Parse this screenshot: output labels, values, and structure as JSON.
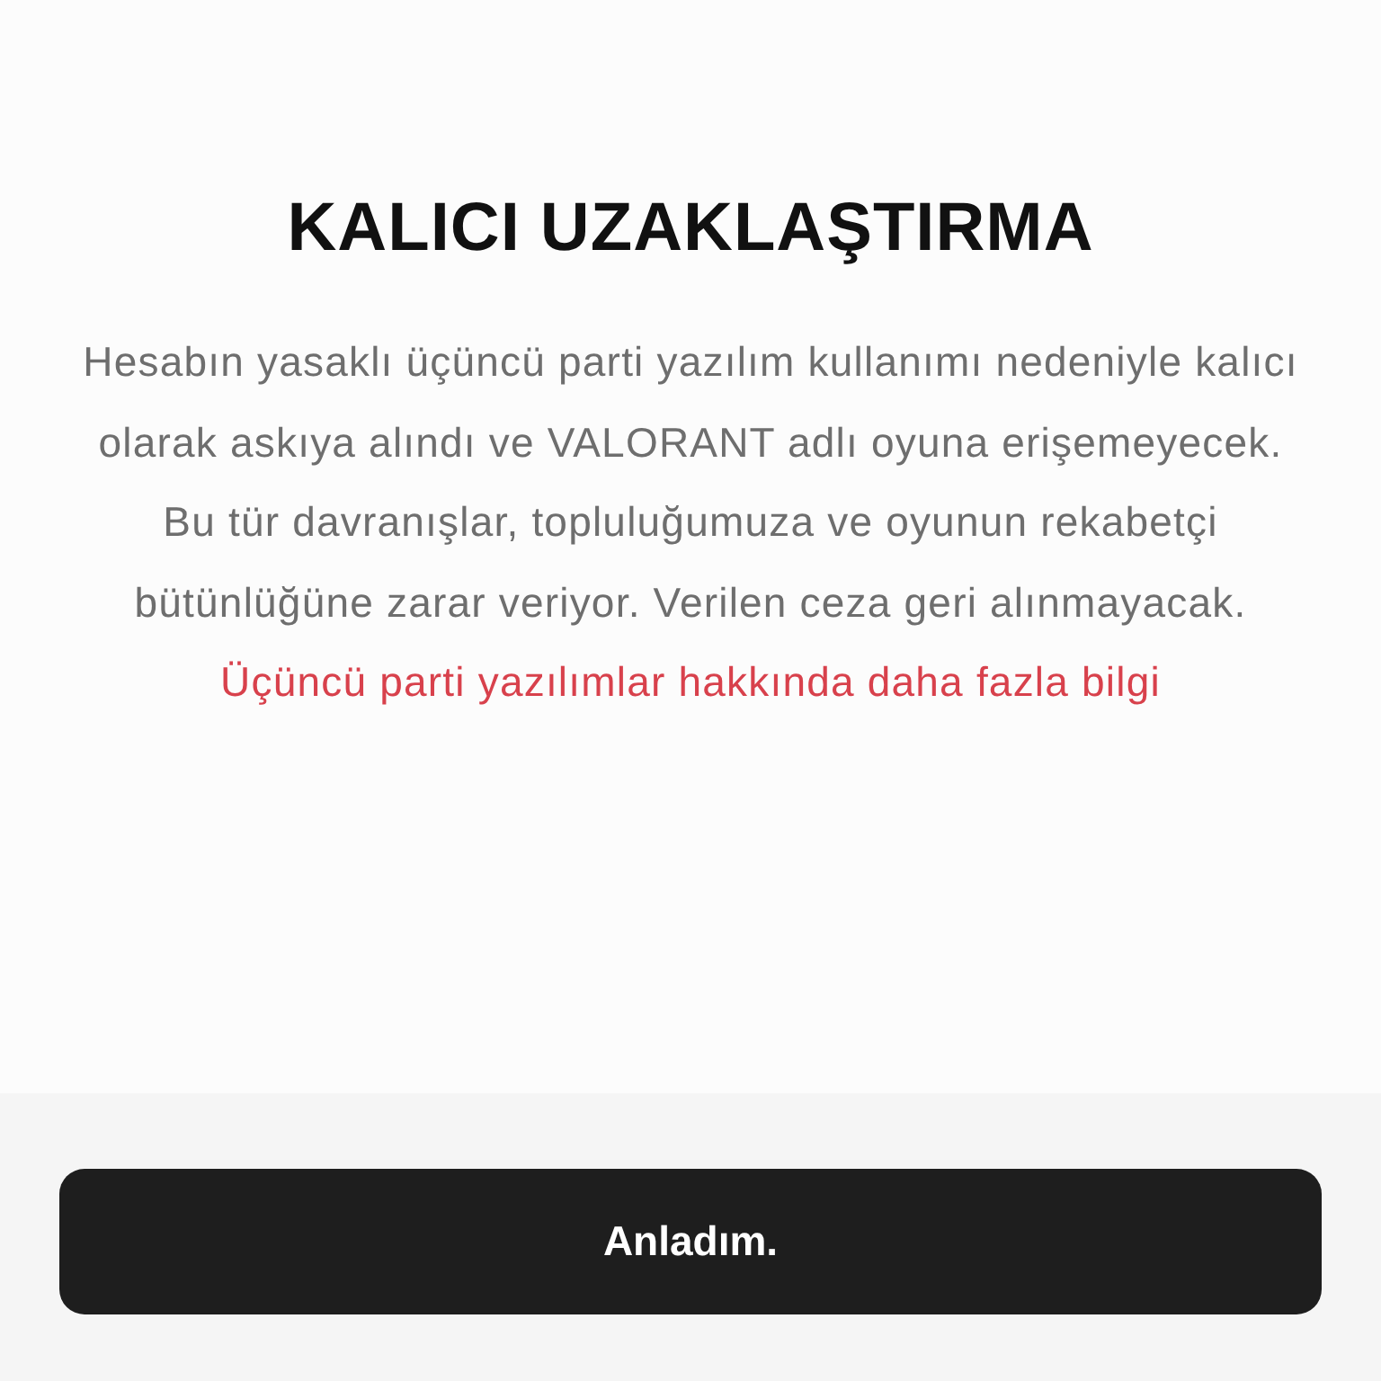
{
  "title": "KALICI UZAKLAŞTIRMA",
  "paragraphs": [
    "Hesabın yasaklı üçüncü parti yazılım kullanımı nedeniyle kalıcı olarak askıya alındı ve VALORANT adlı oyuna erişemeyecek.",
    "Bu tür davranışlar, topluluğumuza ve oyunun rekabetçi bütünlüğüne zarar veriyor. Verilen ceza geri alınmayacak."
  ],
  "link": "Üçüncü parti yazılımlar hakkında daha fazla bilgi",
  "button": "Anladım."
}
